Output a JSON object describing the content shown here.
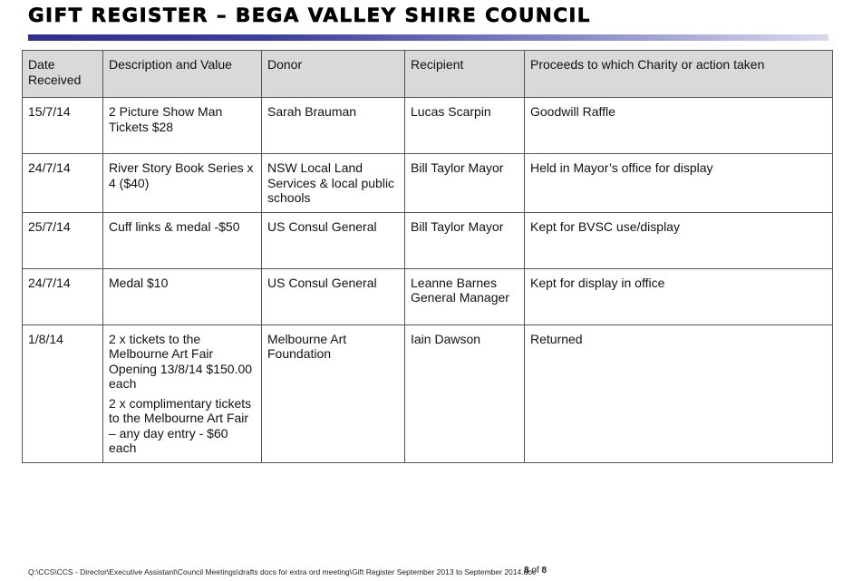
{
  "title": "GIFT REGISTER – BEGA VALLEY SHIRE COUNCIL",
  "table": {
    "headers": [
      "Date Received",
      "Description and Value",
      "Donor",
      "Recipient",
      "Proceeds to which Charity or action taken"
    ],
    "rows": [
      {
        "date": "15/7/14",
        "description": [
          "2 Picture Show Man Tickets $28"
        ],
        "donor": "Sarah Brauman",
        "recipient": "Lucas Scarpin",
        "action": "Goodwill Raffle"
      },
      {
        "date": "24/7/14",
        "description": [
          "River Story Book Series x 4 ($40)"
        ],
        "donor": "NSW Local Land Services & local public schools",
        "recipient": "Bill Taylor Mayor",
        "action": "Held in Mayor’s office for display"
      },
      {
        "date": "25/7/14",
        "description": [
          "Cuff links & medal -$50"
        ],
        "donor": "US Consul General",
        "recipient": "Bill Taylor Mayor",
        "action": "Kept for BVSC use/display"
      },
      {
        "date": "24/7/14",
        "description": [
          "Medal $10"
        ],
        "donor": "US Consul General",
        "recipient": "Leanne Barnes General Manager",
        "action": "Kept for display in office"
      },
      {
        "date": "1/8/14",
        "description": [
          "2 x tickets to the Melbourne Art Fair Opening 13/8/14 $150.00 each",
          "2 x complimentary tickets to the Melbourne Art Fair – any day entry - $60 each"
        ],
        "donor": "Melbourne Art Foundation",
        "recipient": "Iain Dawson",
        "action": "Returned"
      }
    ]
  },
  "footer": {
    "file_path": "Q:\\CCS\\CCS - Director\\Executive Assistant\\Council Meetings\\drafts docs for extra ord meeting\\Gift Register September 2013 to September 2014.doc",
    "page_current": "8",
    "page_of": "of",
    "page_total": "8"
  }
}
